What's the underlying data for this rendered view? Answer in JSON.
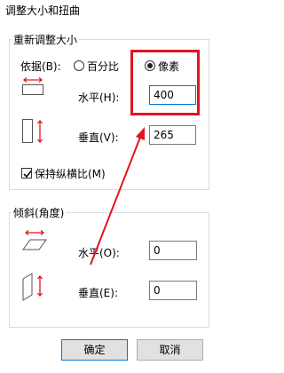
{
  "window": {
    "title": "调整大小和扭曲"
  },
  "resize": {
    "legend": "重新调整大小",
    "by_label": "依据(B):",
    "percent_label": "百分比",
    "pixels_label": "像素",
    "selected": "pixels",
    "horizontal_label": "水平(H):",
    "horizontal_value": "400",
    "vertical_label": "垂直(V):",
    "vertical_value": "265",
    "keep_ratio_label": "保持纵横比(M)",
    "keep_ratio_checked": true
  },
  "skew": {
    "legend": "倾斜(角度)",
    "horizontal_label": "水平(O):",
    "horizontal_value": "0",
    "vertical_label": "垂直(E):",
    "vertical_value": "0"
  },
  "buttons": {
    "ok": "确定",
    "cancel": "取消"
  },
  "annotation": {
    "color": "#e3141c"
  }
}
